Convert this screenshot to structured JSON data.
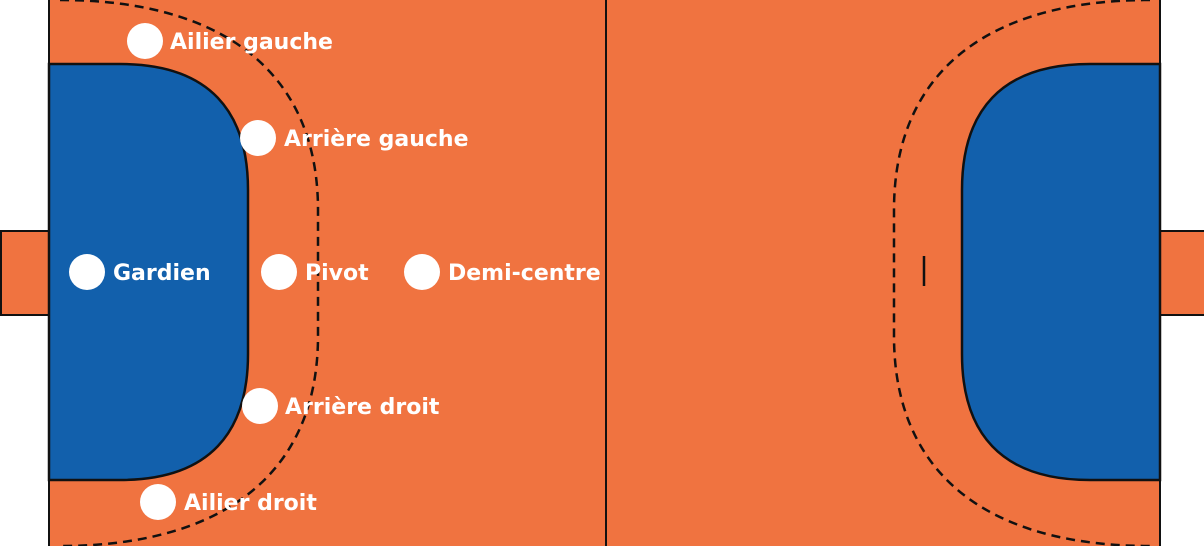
{
  "colors": {
    "court": "#f07340",
    "goal_area": "#1260ac",
    "line": "#111111",
    "player": "#ffffff",
    "label": "#ffffff",
    "background": "#ffffff"
  },
  "players": [
    {
      "id": "ailier-gauche",
      "label": "Ailier gauche"
    },
    {
      "id": "arriere-gauche",
      "label": "Arrière gauche"
    },
    {
      "id": "gardien",
      "label": "Gardien"
    },
    {
      "id": "pivot",
      "label": "Pivot"
    },
    {
      "id": "demi-centre",
      "label": "Demi-centre"
    },
    {
      "id": "arriere-droit",
      "label": "Arrière droit"
    },
    {
      "id": "ailier-droit",
      "label": "Ailier droit"
    }
  ]
}
